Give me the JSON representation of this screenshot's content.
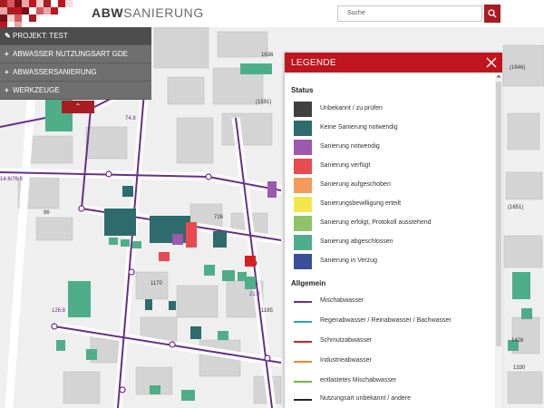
{
  "header": {
    "logo_bold": "ABW",
    "logo_light": "SANIERUNG",
    "search_placeholder": "Suche",
    "icons": {
      "search": "search-icon"
    }
  },
  "menu": {
    "items": [
      {
        "icon": "pencil-icon",
        "glyph": "✎",
        "label": "PROJEKT: TEST"
      },
      {
        "icon": "plus-icon",
        "glyph": "+",
        "label": "ABWASSER NUTZUNGSART GDE"
      },
      {
        "icon": "plus-icon",
        "glyph": "+",
        "label": "ABWASSERSANIERUNG"
      },
      {
        "icon": "plus-icon",
        "glyph": "+",
        "label": "WERKZEUGE"
      }
    ],
    "toggle_glyph": "⌃"
  },
  "legend": {
    "title": "LEGENDE",
    "status_heading": "Status",
    "status": [
      {
        "label": "Unbekannt / zu prüfen",
        "color": "#404040"
      },
      {
        "label": "Keine Sanierung notwendig",
        "color": "#2e6b6d"
      },
      {
        "label": "Sanierung notwendig",
        "color": "#9b5ab0"
      },
      {
        "label": "Sanierung verfügt",
        "color": "#e84a4f"
      },
      {
        "label": "Sanierung aufgeschoben",
        "color": "#f59a5a"
      },
      {
        "label": "Sanierungsbewilligung erteilt",
        "color": "#f2e64a"
      },
      {
        "label": "Sanierung erfolgt, Protokoll ausstehend",
        "color": "#8fc36a"
      },
      {
        "label": "Sanierung abgeschlossen",
        "color": "#4fae8a"
      },
      {
        "label": "Sanierung in Verzug",
        "color": "#3a4f9a"
      }
    ],
    "general_heading": "Allgemein",
    "general": [
      {
        "label": "Mischabwasser",
        "color": "#6b2d8a"
      },
      {
        "label": "Regenabwasser / Reinabwasser / Bachwasser",
        "color": "#29a3c4"
      },
      {
        "label": "Schmutzabwasser",
        "color": "#d42020"
      },
      {
        "label": "Industrieabwasser",
        "color": "#e8862a"
      },
      {
        "label": "entlastetes Mischabwasser",
        "color": "#6cbf3c"
      },
      {
        "label": "Nutzungsart unbekannt / andere",
        "color": "#222222"
      }
    ]
  },
  "map_labels": [
    {
      "text": "1636",
      "name": "map-label-1636"
    },
    {
      "text": "(1646)",
      "name": "map-label-1646"
    },
    {
      "text": "(1591)",
      "name": "map-label-1591"
    },
    {
      "text": "(1651)",
      "name": "map-label-1651"
    },
    {
      "text": "96",
      "name": "map-label-96"
    },
    {
      "text": "726",
      "name": "map-label-726"
    },
    {
      "text": "1170",
      "name": "map-label-1170"
    },
    {
      "text": "1185",
      "name": "map-label-1185"
    },
    {
      "text": "1428",
      "name": "map-label-1428"
    },
    {
      "text": "1330",
      "name": "map-label-1330"
    },
    {
      "text": "14.6/76.5",
      "name": "map-label-pipe-1"
    },
    {
      "text": "74.8",
      "name": "map-label-pipe-2"
    },
    {
      "text": "126.8",
      "name": "map-label-pipe-3"
    },
    {
      "text": "21.0",
      "name": "map-label-pipe-4"
    }
  ]
}
